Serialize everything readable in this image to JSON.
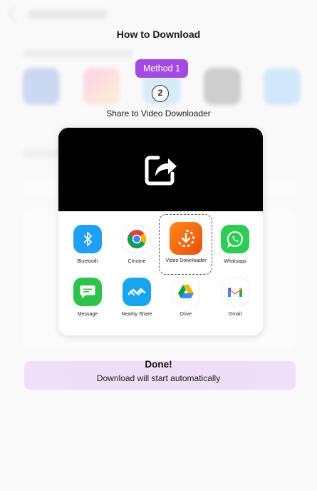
{
  "dialog": {
    "title": "How to Download",
    "method_label": "Method 1",
    "step_number": "2",
    "step_text": "Share to Video Downloader"
  },
  "share_sheet": {
    "icon": "share-icon",
    "apps": [
      {
        "label": "Bluetooth",
        "icon": "bluetooth-icon",
        "color": "#1fa0f5"
      },
      {
        "label": "Chrome",
        "icon": "chrome-icon",
        "color": "#ffffff"
      },
      {
        "label": "Video Downloader",
        "icon": "download-icon",
        "color": "#f26a14",
        "highlighted": true
      },
      {
        "label": "Whatsapp",
        "icon": "whatsapp-icon",
        "color": "#2ecc55"
      },
      {
        "label": "Message",
        "icon": "message-icon",
        "color": "#2fc24a"
      },
      {
        "label": "Nearby Share",
        "icon": "nearby-share-icon",
        "color": "#17a6ee"
      },
      {
        "label": "Drive",
        "icon": "drive-icon",
        "color": "#ffffff"
      },
      {
        "label": "Gmail",
        "icon": "gmail-icon",
        "color": "#ffffff"
      }
    ]
  },
  "status": {
    "title": "Done!",
    "subtitle": "Download will start automatically"
  },
  "colors": {
    "accent": "#a34be0",
    "done_background": "#efe1f7"
  }
}
